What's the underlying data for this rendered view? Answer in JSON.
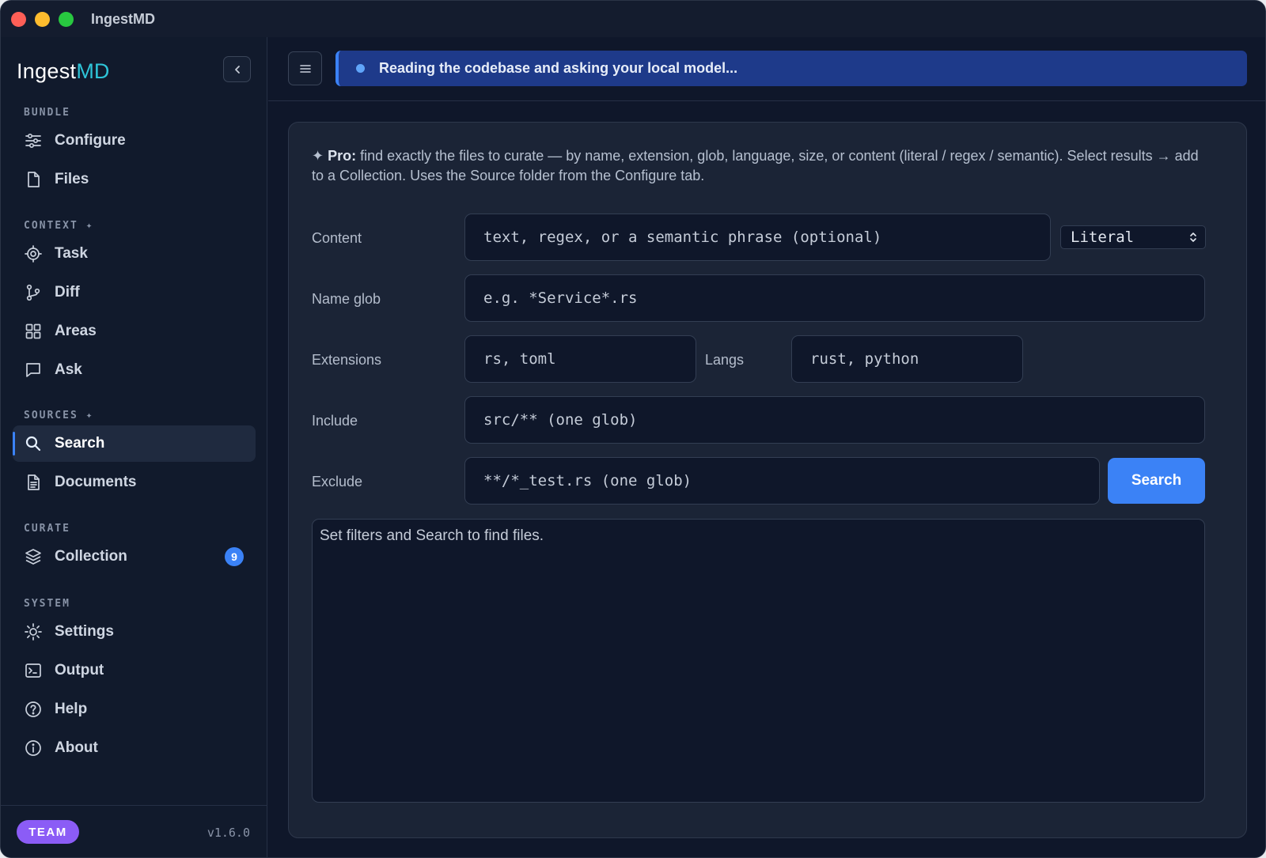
{
  "window": {
    "title": "IngestMD"
  },
  "sidebar": {
    "logo_main": "Ingest",
    "logo_accent": "MD",
    "sections": {
      "bundle": "BUNDLE",
      "context": "CONTEXT ✦",
      "sources": "SOURCES ✦",
      "curate": "CURATE",
      "system": "SYSTEM"
    },
    "items": {
      "configure": "Configure",
      "files": "Files",
      "task": "Task",
      "diff": "Diff",
      "areas": "Areas",
      "ask": "Ask",
      "search": "Search",
      "documents": "Documents",
      "collection": "Collection",
      "settings": "Settings",
      "output": "Output",
      "help": "Help",
      "about": "About"
    },
    "collection_count": "9",
    "active_item": "search",
    "plan_badge": "TEAM",
    "version": "v1.6.0"
  },
  "topbar": {
    "status": "Reading the codebase and asking your local model..."
  },
  "search": {
    "intro_prefix": "✦ ",
    "intro_bold": "Pro:",
    "intro_rest": " find exactly the files to curate — by name, extension, glob, language, size, or content (literal / regex / semantic). Select results → add to a Collection. Uses the Source folder from the Configure tab.",
    "labels": {
      "content": "Content",
      "name_glob": "Name glob",
      "extensions": "Extensions",
      "langs": "Langs",
      "include": "Include",
      "exclude": "Exclude"
    },
    "placeholders": {
      "content": "text, regex, or a semantic phrase (optional)",
      "name_glob": "e.g. *Service*.rs",
      "extensions": "rs, toml",
      "langs": "rust, python",
      "include": "src/** (one glob)",
      "exclude": "**/*_test.rs (one glob)"
    },
    "mode_selected": "Literal",
    "search_button": "Search",
    "results_empty": "Set filters and Search to find files."
  },
  "colors": {
    "accent": "#3b82f6",
    "banner": "#1e3a8a",
    "team": "#8b5cf6",
    "background": "#0f172a"
  }
}
